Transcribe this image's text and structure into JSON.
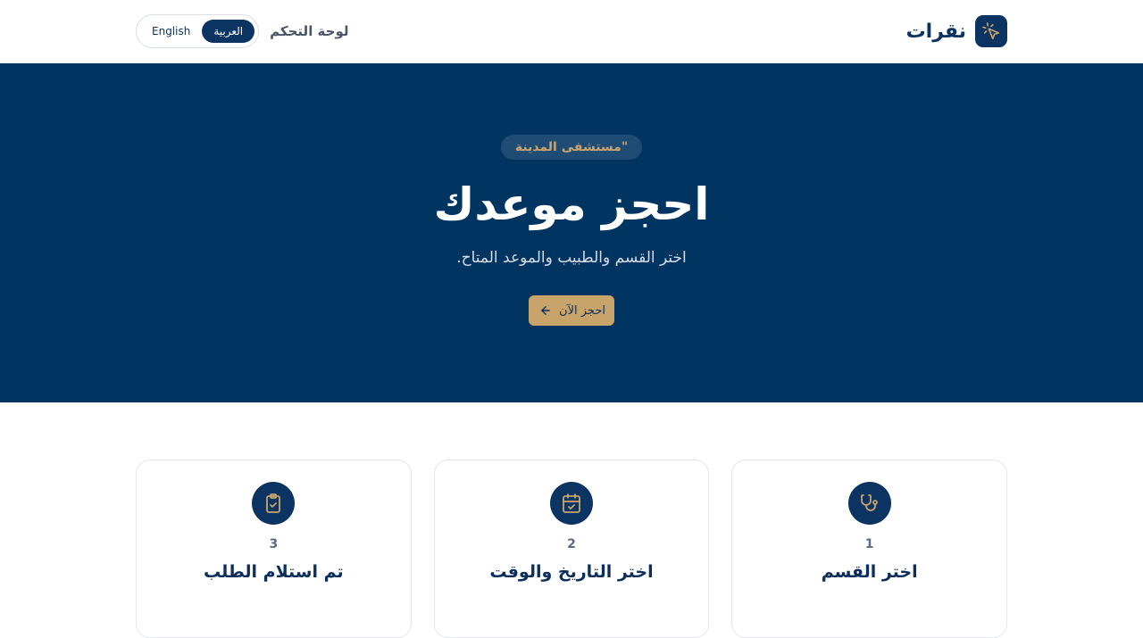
{
  "brand": {
    "name": "نقرات",
    "logo_icon": "cursor-click-icon"
  },
  "nav": {
    "dashboard_label": "لوحة التحكم",
    "languages": [
      {
        "label": "العربية",
        "active": true
      },
      {
        "label": "English",
        "active": false
      }
    ]
  },
  "hero": {
    "badge": "\"مستشفى المدينة",
    "title": "احجز موعدك",
    "subtitle": "اختر القسم والطبيب والموعد المتاح.",
    "cta_label": "احجز الآن",
    "cta_icon": "arrow-left-icon"
  },
  "steps": [
    {
      "number": "1",
      "title": "اختر القسم",
      "icon": "stethoscope-icon"
    },
    {
      "number": "2",
      "title": "اختر التاريخ والوقت",
      "icon": "calendar-check-icon"
    },
    {
      "number": "3",
      "title": "تم استلام الطلب",
      "icon": "clipboard-check-icon"
    }
  ],
  "colors": {
    "primary": "#003461",
    "accent": "#c8a36a",
    "text": "#0b2e5c"
  }
}
